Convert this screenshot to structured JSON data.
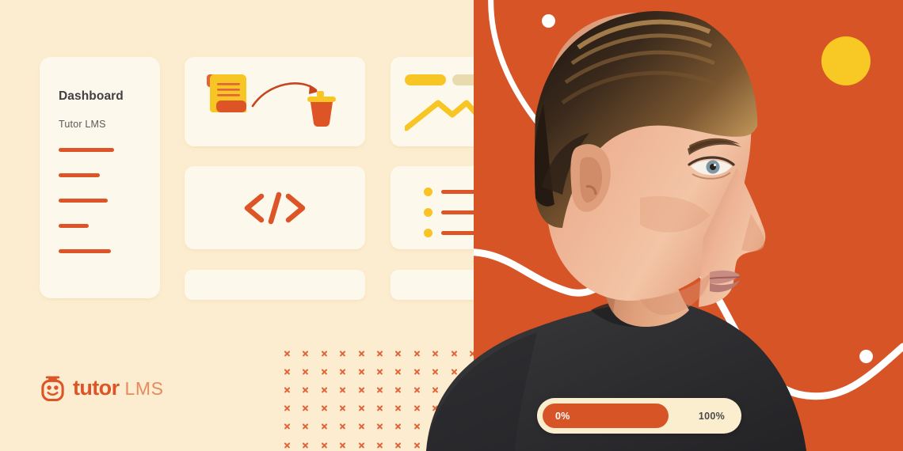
{
  "banner": {
    "background_color": "#FDEDD0",
    "panel_color": "#D75427",
    "card_color": "#FDF8EC",
    "accent_orange": "#DD5427",
    "accent_yellow": "#F8C325"
  },
  "dashboard_card": {
    "title": "Dashboard",
    "subtitle": "Tutor LMS",
    "menu_line_widths": [
      70,
      52,
      62,
      38,
      66
    ]
  },
  "cards": [
    {
      "name": "document-delete-card",
      "icon": "document-to-trash-icon"
    },
    {
      "name": "analytics-card",
      "icon": "line-chart-icon"
    },
    {
      "name": "code-card",
      "icon": "code-icon",
      "glyph": "</>"
    },
    {
      "name": "list-card",
      "icon": "bulleted-list-icon"
    },
    {
      "name": "placeholder-bar-left",
      "icon": "empty-bar"
    },
    {
      "name": "placeholder-bar-right",
      "icon": "empty-bar"
    }
  ],
  "list_card": {
    "line_widths": [
      132,
      132,
      132
    ]
  },
  "logo": {
    "mark": "tutor-lms-owl-icon",
    "word_primary": "tutor",
    "word_secondary": "LMS"
  },
  "progress": {
    "start_label": "0%",
    "end_label": "100%",
    "fill_percent": 67,
    "track_color": "#FAEECF",
    "fill_color": "#D75427"
  },
  "decorations": {
    "yellow_circle": "yellow-circle",
    "white_dot_top": "white-dot",
    "white_dot_bottom": "white-dot",
    "curve_top": "white-curve-line",
    "curve_bottom": "white-wave-line",
    "cross_pattern": "cross-grid-pattern"
  },
  "portrait": {
    "alt": "man-in-profile-photo"
  }
}
